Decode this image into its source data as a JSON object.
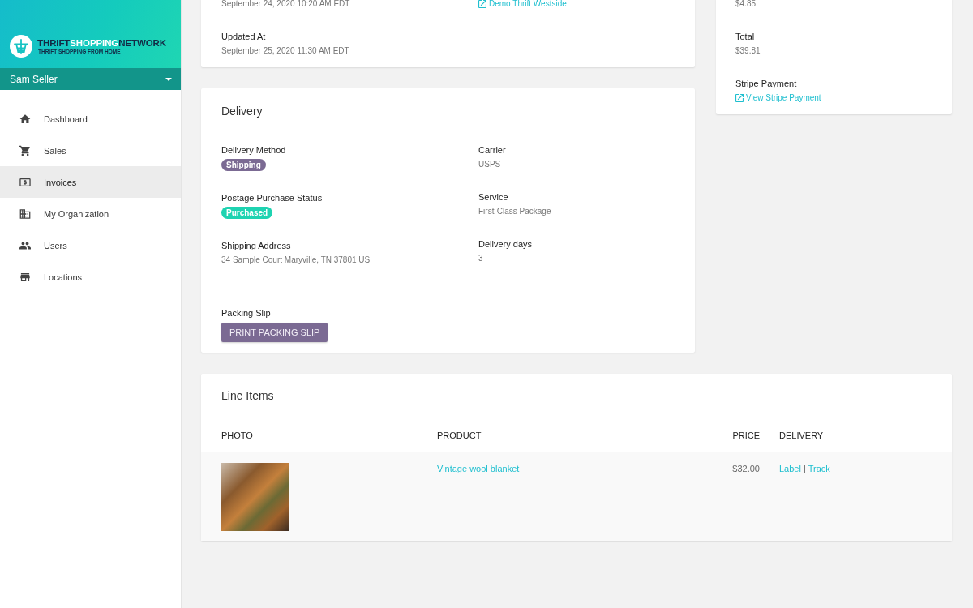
{
  "sidebar": {
    "logo": {
      "wordmark": [
        {
          "text": "THRIFT",
          "color": "#132a45"
        },
        {
          "text": "SHOPPING",
          "color": "#ffffff"
        },
        {
          "text": "NETWORK",
          "color": "#132a45"
        }
      ],
      "tagline": "THRIFT SHOPPING FROM HOME"
    },
    "user": {
      "name": "Sam Seller"
    },
    "items": [
      {
        "label": "Dashboard",
        "selected": false
      },
      {
        "label": "Sales",
        "selected": false
      },
      {
        "label": "Invoices",
        "selected": true
      },
      {
        "label": "My Organization",
        "selected": false
      },
      {
        "label": "Users",
        "selected": false
      },
      {
        "label": "Locations",
        "selected": false
      }
    ]
  },
  "order_card": {
    "columns": [
      [
        {
          "kind": "text",
          "value": "September 24, 2020 10:20 AM EDT"
        },
        {
          "kind": "text",
          "label": "Updated At",
          "value": "September 25, 2020 11:30 AM EDT"
        }
      ],
      [
        {
          "kind": "link",
          "value": "Demo Thrift Westside"
        }
      ]
    ]
  },
  "payment_card": {
    "fields": [
      {
        "kind": "text",
        "value": "$4.85"
      },
      {
        "kind": "text",
        "label": "Total",
        "value": "$39.81"
      },
      {
        "kind": "link",
        "label": "Stripe Payment",
        "value": "View Stripe Payment"
      }
    ]
  },
  "delivery": {
    "title": "Delivery",
    "columns": [
      [
        {
          "kind": "badge",
          "label": "Delivery Method",
          "value": "Shipping",
          "color": "#7b6a93"
        },
        {
          "kind": "badge",
          "label": "Postage Purchase Status",
          "value": "Purchased",
          "color": "#1ed3b1"
        },
        {
          "kind": "text",
          "label": "Shipping Address",
          "value": "34 Sample Court Maryville, TN 37801 US"
        }
      ],
      [
        {
          "kind": "text",
          "label": "Carrier",
          "value": "USPS"
        },
        {
          "kind": "text",
          "label": "Service",
          "value": "First-Class Package"
        },
        {
          "kind": "text",
          "label": "Delivery days",
          "value": "3"
        }
      ]
    ],
    "packing_slip": {
      "label": "Packing Slip",
      "button": "PRINT PACKING SLIP"
    }
  },
  "line_items": {
    "title": "Line Items",
    "columns": [
      "PHOTO",
      "PRODUCT",
      "PRICE",
      "DELIVERY"
    ],
    "rows": [
      {
        "product": "Vintage wool blanket",
        "price": "$32.00",
        "delivery_links": [
          "Label",
          "Track"
        ],
        "separator": "|"
      }
    ]
  }
}
